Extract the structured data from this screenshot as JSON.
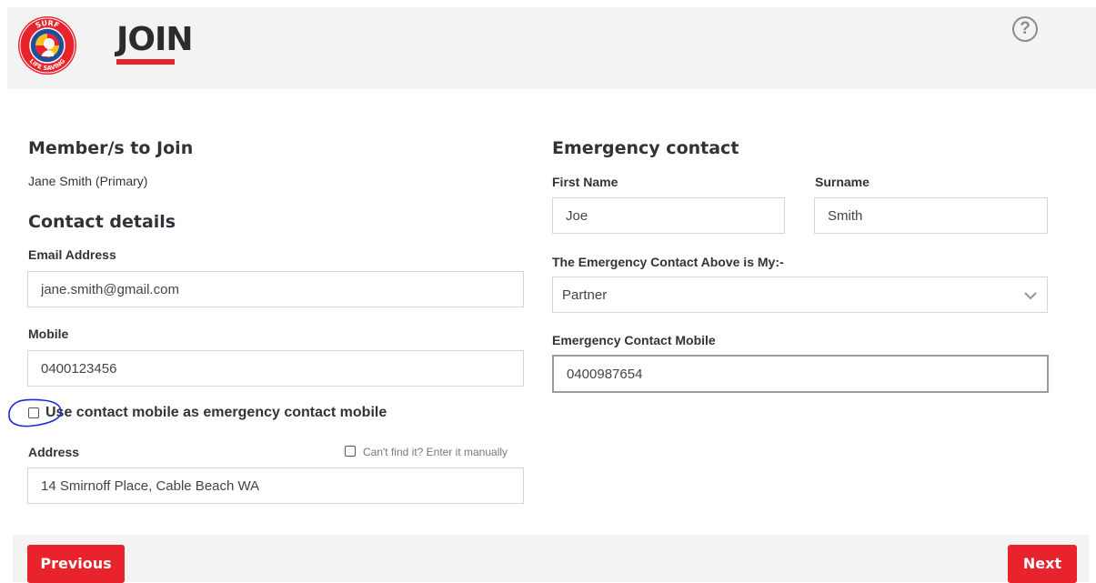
{
  "header": {
    "title": "JOIN",
    "help_label": "?",
    "logo_text_top": "SURF",
    "logo_text_bottom": "LIFE SAVING"
  },
  "members": {
    "heading": "Member/s to Join",
    "primary": "Jane Smith (Primary)"
  },
  "contact": {
    "heading": "Contact details",
    "email_label": "Email Address",
    "email_value": "jane.smith@gmail.com",
    "mobile_label": "Mobile",
    "mobile_value": "0400123456",
    "use_mobile_label": "Use contact mobile as emergency contact mobile",
    "use_mobile_checked": false,
    "address_label": "Address",
    "manual_entry_label": "Can't find it? Enter it manually",
    "address_value": "14 Smirnoff Place, Cable Beach WA"
  },
  "emergency": {
    "heading": "Emergency contact",
    "first_name_label": "First Name",
    "first_name_value": "Joe",
    "surname_label": "Surname",
    "surname_value": "Smith",
    "relation_label": "The Emergency Contact Above is My:-",
    "relation_value": "Partner",
    "mobile_label": "Emergency Contact Mobile",
    "mobile_value": "0400987654"
  },
  "footer": {
    "previous_label": "Previous",
    "next_label": "Next"
  },
  "colors": {
    "accent": "#e8232b",
    "logo_blue": "#1f4e9c",
    "annotation_blue": "#1a2bd6"
  }
}
